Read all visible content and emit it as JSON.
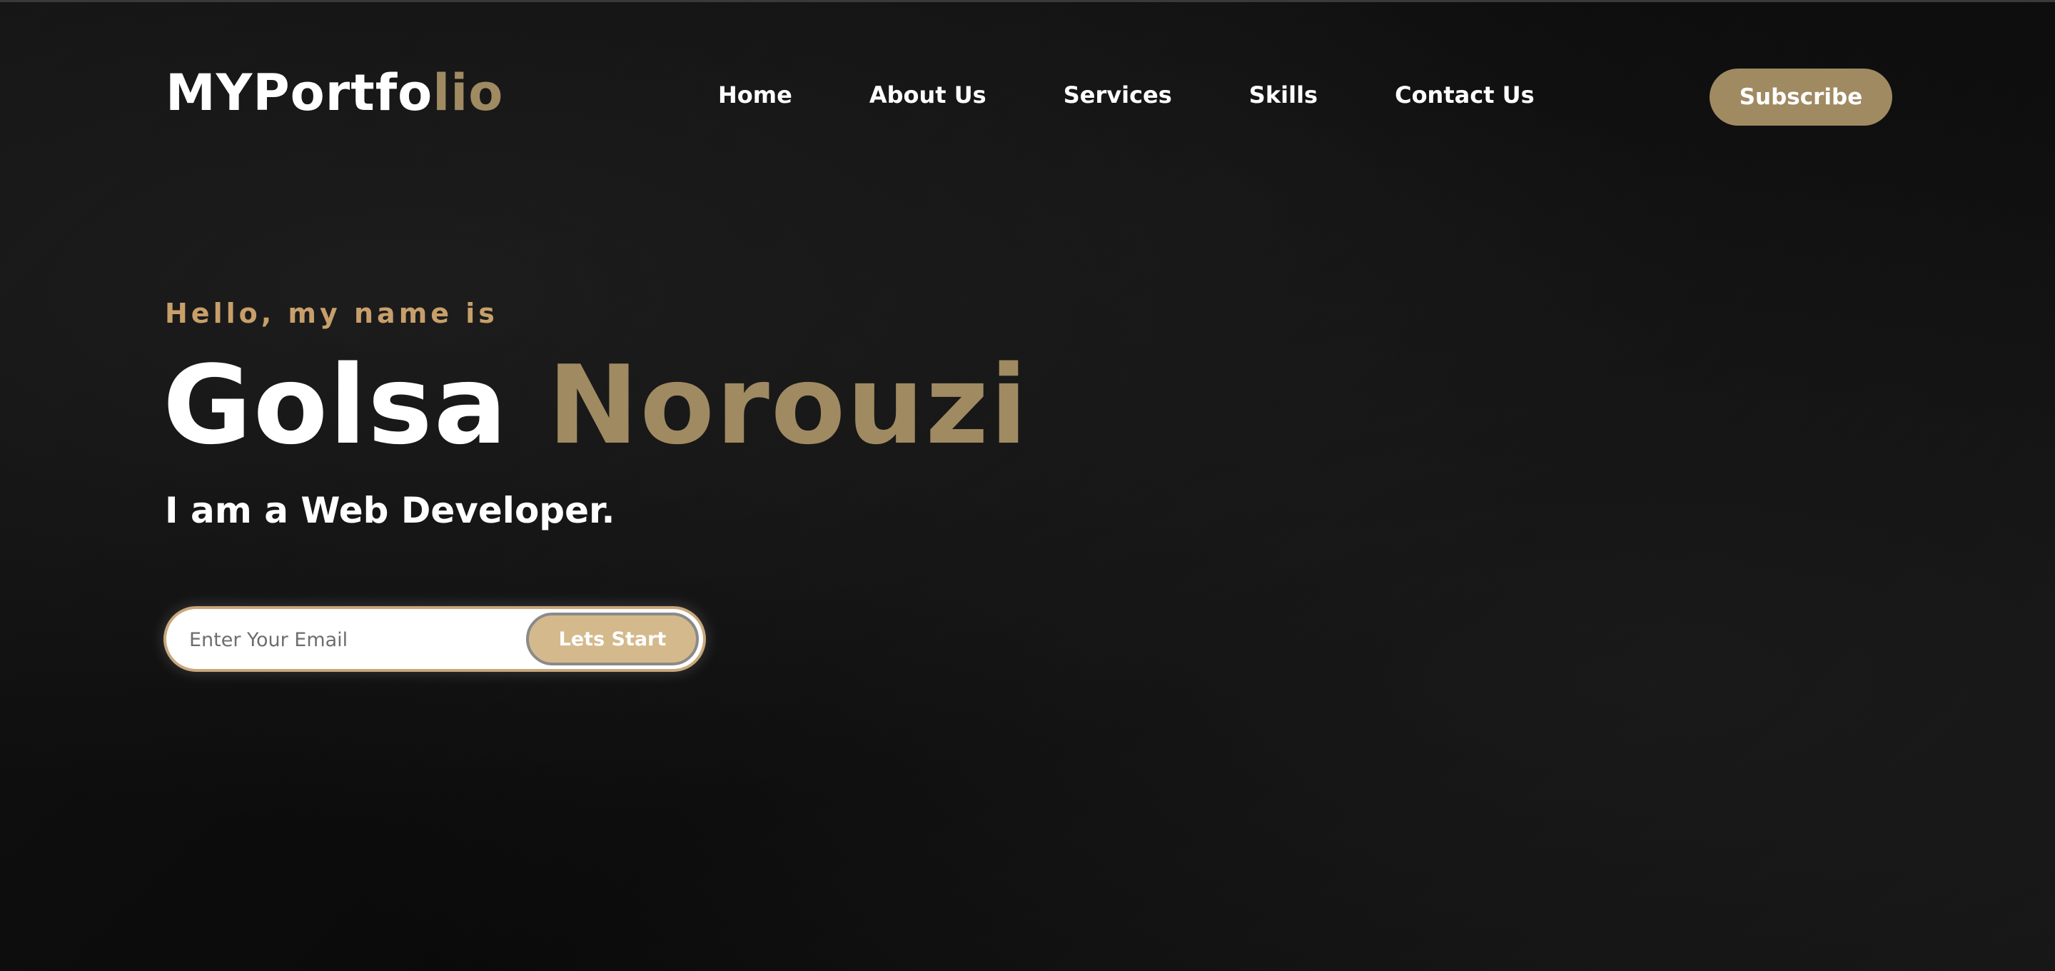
{
  "header": {
    "logo_primary": "MYPortfo",
    "logo_accent": "lio",
    "nav": [
      {
        "label": "Home"
      },
      {
        "label": "About Us"
      },
      {
        "label": "Services"
      },
      {
        "label": "Skills"
      },
      {
        "label": "Contact Us"
      }
    ],
    "subscribe_label": "Subscribe"
  },
  "hero": {
    "greeting": "Hello, my name is",
    "first_name": "Golsa",
    "last_name": "Norouzi",
    "role": "I am a Web Developer.",
    "email_placeholder": "Enter Your Email",
    "email_value": "",
    "start_label": "Lets Start"
  },
  "colors": {
    "background": "#0d0d0d",
    "accent_gold": "#a08a62",
    "greeting_gold": "#c89f6a",
    "button_tan": "#d4b98c",
    "text": "#ffffff"
  }
}
